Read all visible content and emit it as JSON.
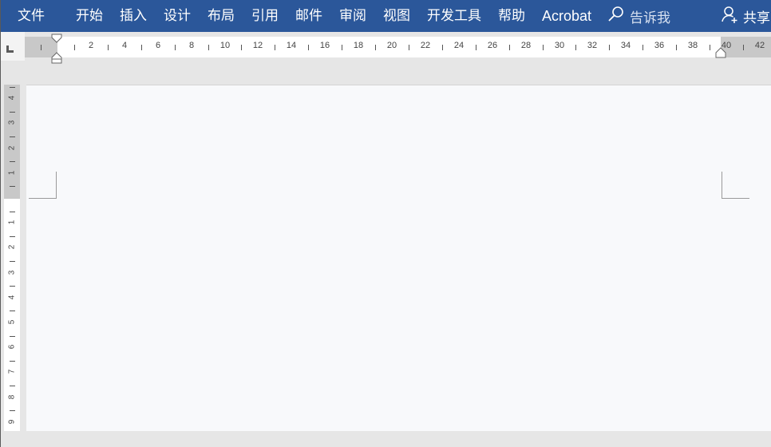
{
  "ribbon": {
    "tabs": [
      "文件",
      "开始",
      "插入",
      "设计",
      "布局",
      "引用",
      "邮件",
      "审阅",
      "视图",
      "开发工具",
      "帮助",
      "Acrobat"
    ],
    "tell_me": "告诉我",
    "share": "共享"
  },
  "ruler": {
    "horizontal_labels": [
      "2",
      "4",
      "6",
      "8",
      "10",
      "12",
      "14",
      "16",
      "18",
      "20",
      "22",
      "24",
      "26",
      "28",
      "30",
      "32",
      "34",
      "36",
      "38",
      "40",
      "42"
    ],
    "vertical_top_labels": [
      "4",
      "3",
      "2",
      "1"
    ],
    "vertical_bottom_labels": [
      "1",
      "2",
      "3",
      "4",
      "5",
      "6",
      "7",
      "8",
      "9"
    ]
  },
  "colors": {
    "ribbon_bg": "#2b579a",
    "ruler_margin": "#c8c8c8",
    "page_bg": "#f8f9fb"
  }
}
